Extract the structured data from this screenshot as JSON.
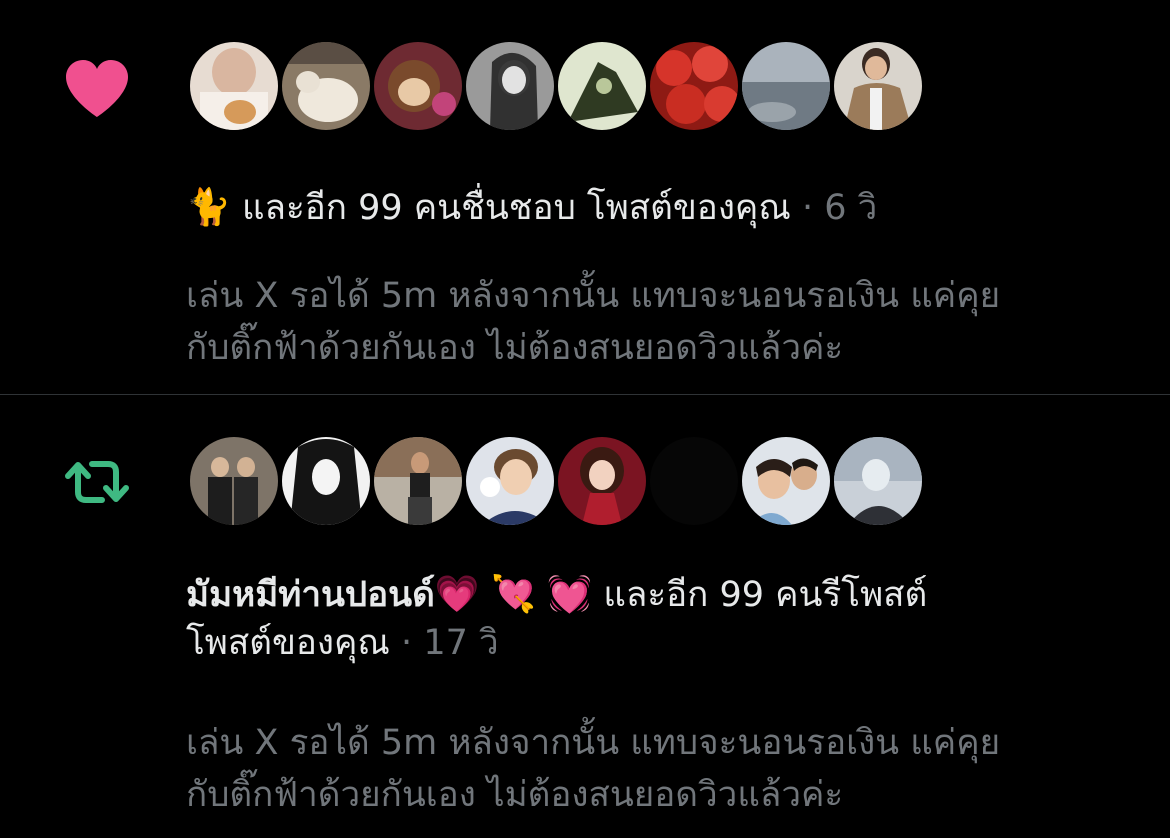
{
  "colors": {
    "heart": "#f0508f",
    "repost": "#3fb982",
    "text": "#e7e9ea",
    "muted": "#71767b",
    "divider": "#2f3336"
  },
  "like_notification": {
    "icon": "heart-icon",
    "lead_emoji": "🐈",
    "action_text": "และอีก 99 คนชื่นชอบ โพสต์ของคุณ",
    "separator": "·",
    "time": "6 วิ",
    "post_line1": "เล่น X รอได้ 5m หลังจากนั้น แทบจะนอนรอเงิน แค่คุย",
    "post_line2": "กับติ๊กฟ้าด้วยกันเอง ไม่ต้องสนยอดวิวแล้วค่ะ"
  },
  "repost_notification": {
    "icon": "repost-icon",
    "user_name": "มัมหมีท่านปอนด์",
    "name_emojis": "💗 💘 💓",
    "action_text": "และอีก 99 คนรีโพสต์",
    "action_text2": "โพสต์ของคุณ",
    "separator": "·",
    "time": "17 วิ",
    "post_line1": "เล่น X รอได้ 5m หลังจากนั้น แทบจะนอนรอเงิน แค่คุย",
    "post_line2": "กับติ๊กฟ้าด้วยกันเอง ไม่ต้องสนยอดวิวแล้วค่ะ"
  }
}
